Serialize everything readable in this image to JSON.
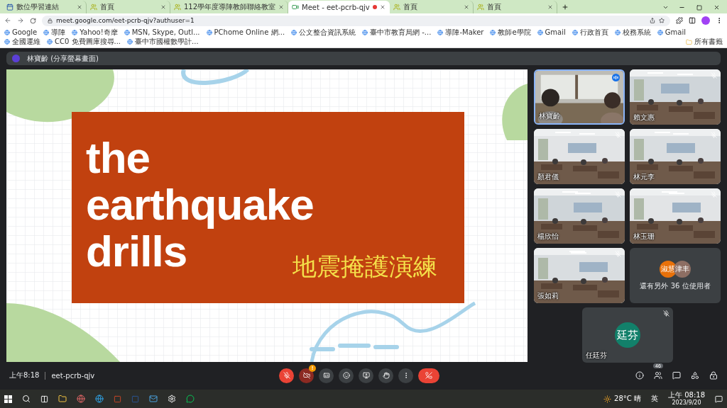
{
  "browser": {
    "tabs": [
      {
        "title": "數位學習連結",
        "selected": false
      },
      {
        "title": "首頁",
        "selected": false
      },
      {
        "title": "112學年度導陣教師聯絡教室",
        "selected": false
      },
      {
        "title": "Meet - eet-pcrb-qjv",
        "selected": true,
        "recording": true
      },
      {
        "title": "首頁",
        "selected": false
      },
      {
        "title": "首頁",
        "selected": false
      }
    ],
    "address": "meet.google.com/eet-pcrb-qjv?authuser=1",
    "bookmarks": [
      "Google",
      "導陣",
      "Yahoo!奇摩",
      "MSN, Skype, Outl...",
      "PChome Online 網...",
      "公文整合資訊系統",
      "臺中市教育局網 -...",
      "導陣-Maker",
      "教師e學院",
      "Gmail",
      "行政首頁",
      "校務系統",
      "Gmail",
      "全國運維",
      "CC0 免費圖庫搜尋...",
      "臺中市國權數學計..."
    ],
    "all_bookmarks": "所有書籤"
  },
  "meet": {
    "presenter": "林寶齡 (分享螢幕畫面)",
    "slide": {
      "title_lines": [
        "the",
        "earthquake",
        "drills"
      ],
      "subtitle": "地震掩護演練"
    },
    "tiles": [
      {
        "name": "林寶齡",
        "muted": false,
        "speaking": true
      },
      {
        "name": "賴文惠",
        "muted": true,
        "speaking": false
      },
      {
        "name": "顏君儀",
        "muted": true,
        "speaking": false
      },
      {
        "name": "林元李",
        "muted": true,
        "speaking": false
      },
      {
        "name": "楊欣怡",
        "muted": true,
        "speaking": false
      },
      {
        "name": "林玉珊",
        "muted": true,
        "speaking": false
      },
      {
        "name": "張如莉",
        "muted": true,
        "speaking": false
      }
    ],
    "others": {
      "avatars": [
        {
          "text": "淑慧",
          "color": "#e8710a"
        },
        {
          "text": "津丰",
          "color": "#8d6e63"
        }
      ],
      "caption": "還有另外 36 位使用者"
    },
    "self": {
      "name": "任廷芬",
      "avatar": "廷芬",
      "muted": true
    },
    "time": "上午8:18",
    "code": "eet-pcrb-qjv",
    "controls": [
      {
        "kind": "mic",
        "on": false
      },
      {
        "kind": "camera",
        "on": false,
        "alert": "!"
      },
      {
        "kind": "captions",
        "on": false
      },
      {
        "kind": "emoji",
        "on": false
      },
      {
        "kind": "present",
        "on": false
      },
      {
        "kind": "hand",
        "on": false
      },
      {
        "kind": "more",
        "on": false
      },
      {
        "kind": "leave",
        "on": false
      }
    ],
    "people_count": "46"
  },
  "taskbar": {
    "weather": "28°C 晴",
    "ime": "英",
    "time": "上午 08:18",
    "date": "2023/9/20"
  }
}
